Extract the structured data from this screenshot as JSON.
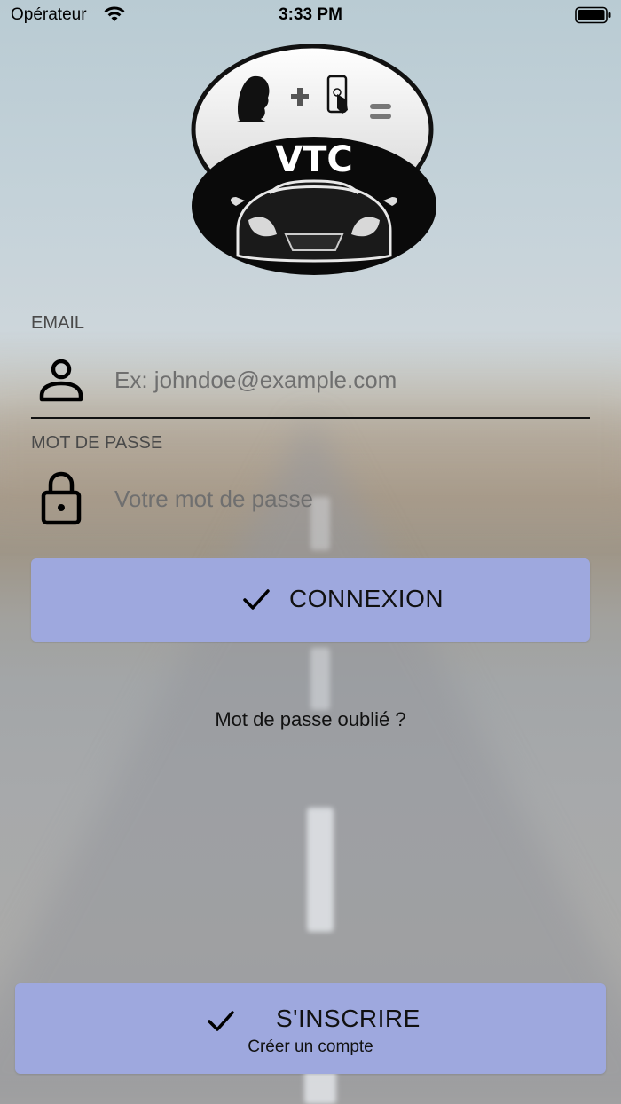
{
  "status_bar": {
    "carrier": "Opérateur",
    "time": "3:33 PM"
  },
  "logo": {
    "text": "VTC"
  },
  "form": {
    "email_label": "EMAIL",
    "email_placeholder": "Ex: johndoe@example.com",
    "password_label": "MOT DE PASSE",
    "password_placeholder": "Votre mot de passe"
  },
  "actions": {
    "login_label": "CONNEXION",
    "forgot_password": "Mot de passe oublié ?",
    "signup_label": "S'INSCRIRE",
    "signup_sublabel": "Créer un compte"
  },
  "colors": {
    "button_bg": "#9ea8de",
    "text": "#111111"
  },
  "icons": [
    "wifi-icon",
    "battery-icon",
    "person-icon",
    "lock-icon",
    "checkmark-icon"
  ]
}
